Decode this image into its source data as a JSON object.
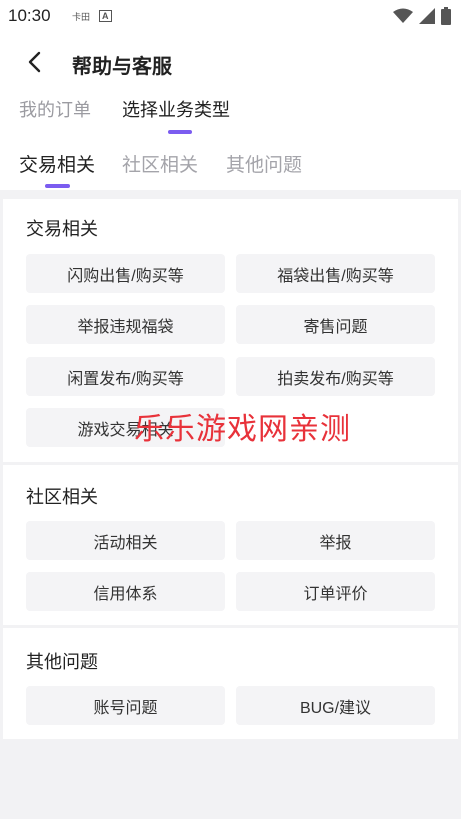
{
  "status_bar": {
    "time": "10:30",
    "icon1": "卡田",
    "icon2": "A"
  },
  "nav": {
    "title": "帮助与客服"
  },
  "top_tabs": [
    {
      "label": "我的订单",
      "active": false
    },
    {
      "label": "选择业务类型",
      "active": true
    }
  ],
  "sub_tabs": [
    {
      "label": "交易相关",
      "active": true
    },
    {
      "label": "社区相关",
      "active": false
    },
    {
      "label": "其他问题",
      "active": false
    }
  ],
  "sections": [
    {
      "title": "交易相关",
      "items": [
        "闪购出售/购买等",
        "福袋出售/购买等",
        "举报违规福袋",
        "寄售问题",
        "闲置发布/购买等",
        "拍卖发布/购买等",
        "游戏交易相关"
      ]
    },
    {
      "title": "社区相关",
      "items": [
        "活动相关",
        "举报",
        "信用体系",
        "订单评价"
      ]
    },
    {
      "title": "其他问题",
      "items": [
        "账号问题",
        "BUG/建议"
      ]
    }
  ],
  "watermark": "乐乐游戏网亲测",
  "colors": {
    "accent": "#7b5cf0",
    "watermark": "#e8323a",
    "button_bg": "#f4f4f6",
    "page_bg": "#f2f2f4"
  }
}
